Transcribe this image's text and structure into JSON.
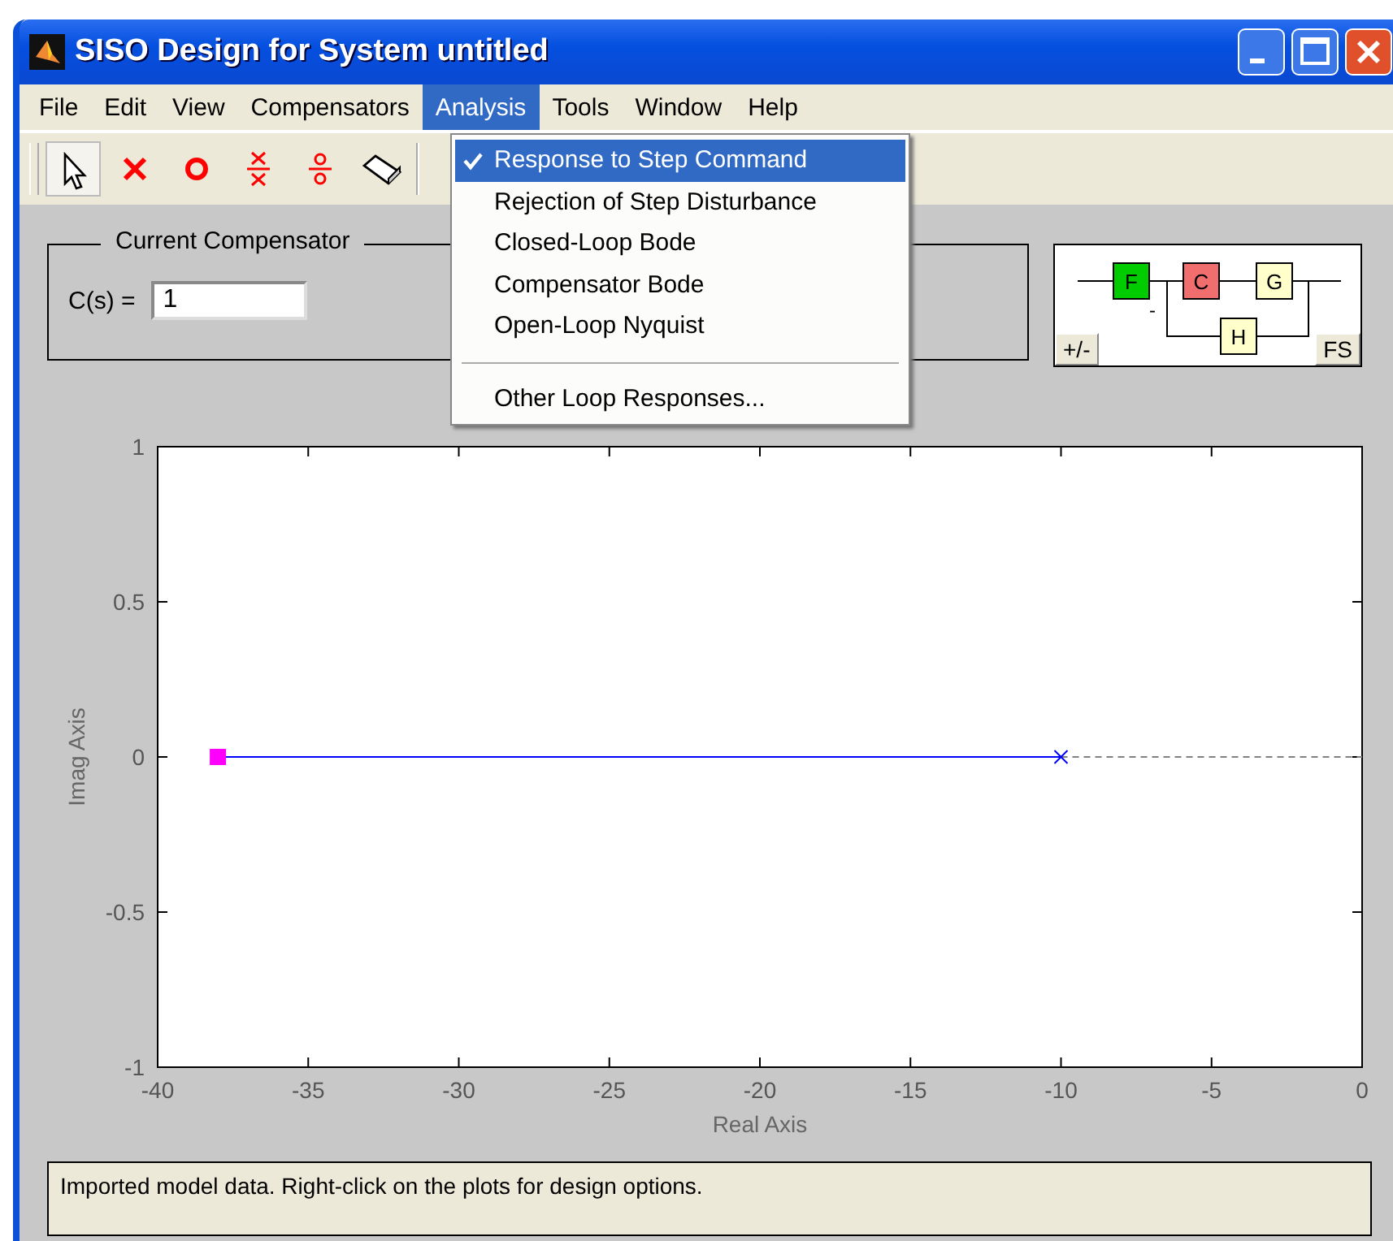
{
  "window": {
    "title": "SISO Design for System untitled"
  },
  "menu_bar": [
    {
      "label": "File",
      "selected": false
    },
    {
      "label": "Edit",
      "selected": false
    },
    {
      "label": "View",
      "selected": false
    },
    {
      "label": "Compensators",
      "selected": false
    },
    {
      "label": "Analysis",
      "selected": true
    },
    {
      "label": "Tools",
      "selected": false
    },
    {
      "label": "Window",
      "selected": false
    },
    {
      "label": "Help",
      "selected": false
    }
  ],
  "toolbar": [
    {
      "kind": "pointer",
      "selected": true
    },
    {
      "kind": "pole",
      "selected": false
    },
    {
      "kind": "zero",
      "selected": false
    },
    {
      "kind": "pole-pair",
      "selected": false
    },
    {
      "kind": "zero-pair",
      "selected": false
    },
    {
      "kind": "eraser",
      "selected": false
    }
  ],
  "analysis_menu": [
    {
      "label": "Response to Step Command",
      "checked": true,
      "selected": true,
      "kind": "item"
    },
    {
      "label": "Rejection of Step Disturbance",
      "checked": false,
      "selected": false,
      "kind": "item"
    },
    {
      "label": "Closed-Loop Bode",
      "checked": false,
      "selected": false,
      "kind": "item"
    },
    {
      "label": "Compensator Bode",
      "checked": false,
      "selected": false,
      "kind": "item"
    },
    {
      "label": "Open-Loop Nyquist",
      "checked": false,
      "selected": false,
      "kind": "item"
    },
    {
      "kind": "separator"
    },
    {
      "label": "Other Loop Responses...",
      "checked": false,
      "selected": false,
      "kind": "item"
    }
  ],
  "compensator": {
    "title": "Current Compensator",
    "label": "C(s) =",
    "value": "1"
  },
  "diagram": {
    "blocks": [
      {
        "label": "F",
        "color": "#00cc00"
      },
      {
        "label": "C",
        "color": "#f06e6e"
      },
      {
        "label": "G",
        "color": "#ffffcc"
      },
      {
        "label": "H",
        "color": "#ffffcc"
      }
    ],
    "sign": "-",
    "buttons": [
      "+/-",
      "FS"
    ]
  },
  "plot": {
    "chart_data": {
      "type": "line",
      "xlabel": "Real Axis",
      "ylabel": "Imag Axis",
      "xlim": [
        -40,
        0
      ],
      "ylim": [
        -1,
        1
      ],
      "xticks": [
        -40,
        -35,
        -30,
        -25,
        -20,
        -15,
        -10,
        -5,
        0
      ],
      "yticks": [
        -1,
        -0.5,
        0,
        0.5,
        1
      ],
      "series": [
        {
          "color": "#0000ff",
          "x": [
            -38,
            -10
          ],
          "values": [
            0,
            0
          ],
          "line_style": "solid",
          "marker": "none"
        },
        {
          "color": "#808080",
          "x": [
            -10,
            0
          ],
          "values": [
            0,
            0
          ],
          "line_style": "dashed",
          "marker": "none"
        },
        {
          "color": "#ff00ff",
          "x": [
            -38
          ],
          "values": [
            0
          ],
          "line_style": "none",
          "marker": "square"
        },
        {
          "color": "#0000ff",
          "x": [
            -10
          ],
          "values": [
            0
          ],
          "line_style": "none",
          "marker": "x"
        }
      ]
    }
  },
  "status": "Imported model data. Right-click on the plots for design options."
}
